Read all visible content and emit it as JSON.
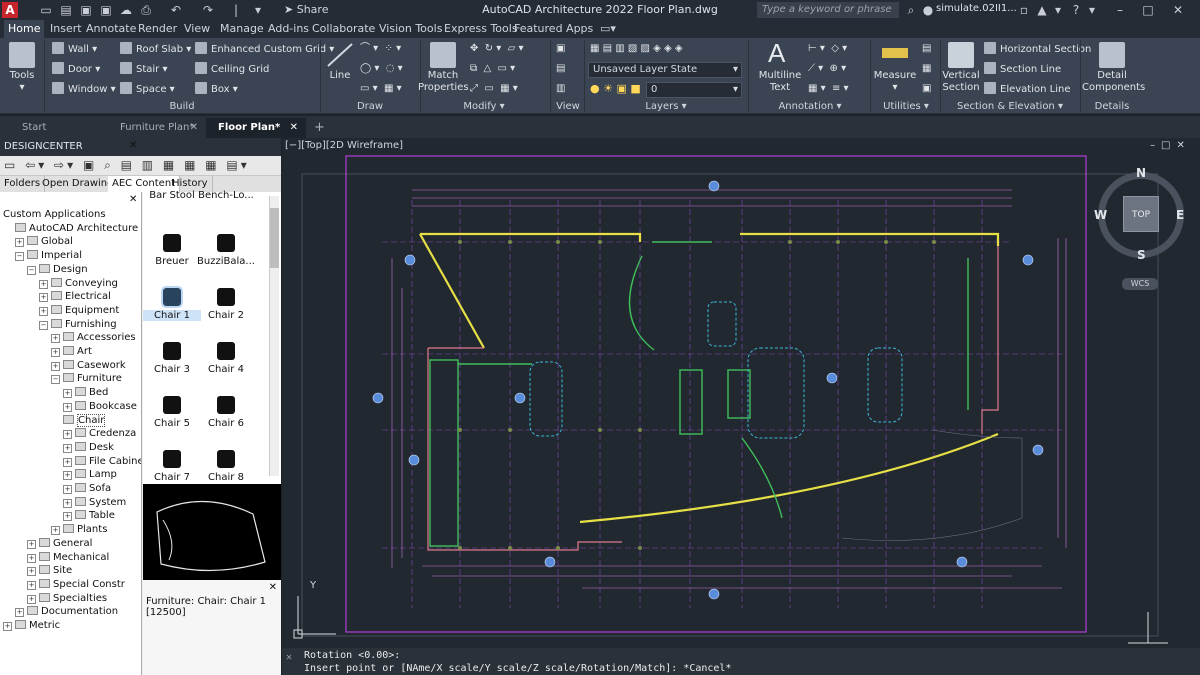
{
  "app": {
    "title": "AutoCAD Architecture 2022    Floor Plan.dwg",
    "share_label": "Share",
    "app_letter": "A"
  },
  "search": {
    "placeholder": "Type a keyword or phrase"
  },
  "user": {
    "name": "simulate.02II1..."
  },
  "ribbon_tabs": [
    "Home",
    "Insert",
    "Annotate",
    "Render",
    "View",
    "Manage",
    "Add-ins",
    "Collaborate",
    "Vision Tools",
    "Express Tools",
    "Featured Apps"
  ],
  "ribbon": {
    "tools_label": "Tools",
    "build": {
      "label": "Build",
      "items": [
        "Wall",
        "Door",
        "Window",
        "Roof Slab",
        "Stair",
        "Space",
        "Enhanced Custom Grid",
        "Ceiling Grid",
        "Box"
      ]
    },
    "draw": {
      "label": "Draw",
      "line_label": "Line"
    },
    "modify": {
      "label": "Modify",
      "match_label": "Match",
      "properties_label": "Properties"
    },
    "view": {
      "label": "View"
    },
    "layers": {
      "label": "Layers",
      "layer_state": "Unsaved Layer State",
      "layer_value": "0"
    },
    "annotation": {
      "label": "Annotation",
      "multiline_label": "Multiline",
      "text_label": "Text"
    },
    "utilities": {
      "label": "Utilities",
      "measure_label": "Measure"
    },
    "section": {
      "label": "Section & Elevation",
      "vertical_label": "Vertical",
      "section_label": "Section",
      "items": [
        "Horizontal Section",
        "Section Line",
        "Elevation Line"
      ]
    },
    "details": {
      "label": "Details",
      "detail_label": "Detail",
      "components_label": "Components"
    }
  },
  "doc_tabs": [
    "Start",
    "Furniture Plan*",
    "Floor Plan*"
  ],
  "designcenter": {
    "title": "DESIGNCENTER",
    "tabs": [
      "Folders",
      "Open Drawings",
      "AEC Content",
      "History"
    ],
    "tree": [
      {
        "label": "Custom Applications",
        "indent": 0,
        "type": "none"
      },
      {
        "label": "AutoCAD Architecture",
        "indent": 1,
        "type": "none"
      },
      {
        "label": "Global",
        "indent": 1,
        "type": "plus"
      },
      {
        "label": "Imperial",
        "indent": 1,
        "type": "minus"
      },
      {
        "label": "Design",
        "indent": 2,
        "type": "minus"
      },
      {
        "label": "Conveying",
        "indent": 3,
        "type": "plus"
      },
      {
        "label": "Electrical",
        "indent": 3,
        "type": "plus"
      },
      {
        "label": "Equipment",
        "indent": 3,
        "type": "plus"
      },
      {
        "label": "Furnishing",
        "indent": 3,
        "type": "minus"
      },
      {
        "label": "Accessories",
        "indent": 4,
        "type": "plus"
      },
      {
        "label": "Art",
        "indent": 4,
        "type": "plus"
      },
      {
        "label": "Casework",
        "indent": 4,
        "type": "plus"
      },
      {
        "label": "Furniture",
        "indent": 4,
        "type": "minus"
      },
      {
        "label": "Bed",
        "indent": 5,
        "type": "plus"
      },
      {
        "label": "Bookcase",
        "indent": 5,
        "type": "plus"
      },
      {
        "label": "Chair",
        "indent": 5,
        "type": "none"
      },
      {
        "label": "Credenza",
        "indent": 5,
        "type": "plus"
      },
      {
        "label": "Desk",
        "indent": 5,
        "type": "plus"
      },
      {
        "label": "File Cabinet",
        "indent": 5,
        "type": "plus"
      },
      {
        "label": "Lamp",
        "indent": 5,
        "type": "plus"
      },
      {
        "label": "Sofa",
        "indent": 5,
        "type": "plus"
      },
      {
        "label": "System",
        "indent": 5,
        "type": "plus"
      },
      {
        "label": "Table",
        "indent": 5,
        "type": "plus"
      },
      {
        "label": "Plants",
        "indent": 4,
        "type": "plus"
      },
      {
        "label": "General",
        "indent": 2,
        "type": "plus"
      },
      {
        "label": "Mechanical",
        "indent": 2,
        "type": "plus"
      },
      {
        "label": "Site",
        "indent": 2,
        "type": "plus"
      },
      {
        "label": "Special Constr",
        "indent": 2,
        "type": "plus"
      },
      {
        "label": "Specialties",
        "indent": 2,
        "type": "plus"
      },
      {
        "label": "Documentation",
        "indent": 1,
        "type": "plus"
      },
      {
        "label": "Metric",
        "indent": 0,
        "type": "plus"
      }
    ],
    "palette": [
      "Bar Stool",
      "Bench-Lo...",
      "Breuer",
      "BuzziBala...",
      "Chair 1",
      "Chair 2",
      "Chair 3",
      "Chair 4",
      "Chair 5",
      "Chair 6",
      "Chair 7",
      "Chair 8"
    ],
    "description_line1": "Furniture: Chair: Chair 1",
    "description_line2": "[12500]"
  },
  "viewport": {
    "label": "[−][Top][2D Wireframe]"
  },
  "viewcube": {
    "n": "N",
    "s": "S",
    "e": "E",
    "w": "W",
    "top": "TOP",
    "wcs": "WCS"
  },
  "ucs": {
    "y": "Y"
  },
  "command": {
    "line1": "Rotation <0.00>:",
    "line2": "Insert point or [NAme/X scale/Y scale/Z scale/Rotation/Match]: *Cancel*"
  },
  "colors": {
    "wall": "#e7df46",
    "grid": "#9a4fc4",
    "dim": "#c77ad8",
    "green": "#3fbf5a",
    "cyan": "#3db7d8",
    "bg": "#212830"
  }
}
